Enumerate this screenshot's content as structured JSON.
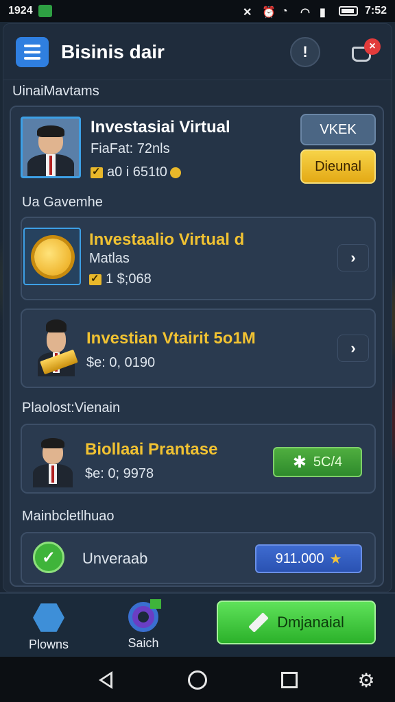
{
  "status_bar": {
    "time_left": "1924",
    "time_right": "7:52"
  },
  "header": {
    "title": "Bisinis dair"
  },
  "sections": {
    "section1_label": "UinaiMavtams",
    "section2_label": "Ua Gavemhe",
    "section3_label": "Plaolost:Vienain",
    "section4_label": "Mainbcletlhuao"
  },
  "profile_card": {
    "title": "Investasiai Virtual",
    "subtitle": "FiaFat: 72nls",
    "value": "a0 i 651t0",
    "view_button": "VKEK",
    "action_button": "Dieunal"
  },
  "item1": {
    "title": "Investaalio Virtual d",
    "subtitle": "Matlas",
    "value": "1 $;068",
    "prefix": "1"
  },
  "item2": {
    "title": "Investian Vtairit 5o1M",
    "value": "$e: 0, 0190"
  },
  "item3": {
    "title": "Biollaai Prantase",
    "value": "$e: 0; 9978",
    "button_value": "5C/4"
  },
  "item4": {
    "label": "Unveraab",
    "button_value": "911.000"
  },
  "bottom_nav": {
    "item1_label": "Plowns",
    "item2_label": "Saich",
    "main_button": "Dmjanaial"
  },
  "colors": {
    "accent_blue": "#2f7fe0",
    "gold": "#f1c232",
    "green": "#2bb12a",
    "badge_red": "#e23b3b"
  }
}
